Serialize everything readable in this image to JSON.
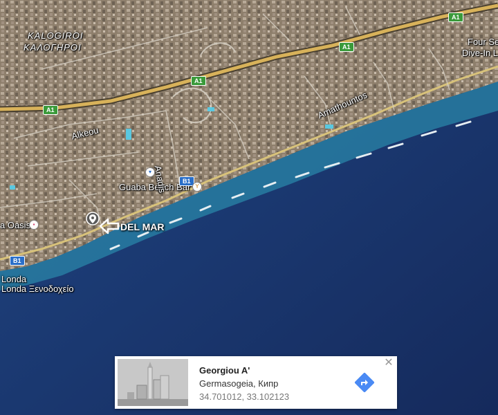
{
  "map": {
    "places": {
      "kalogiroi_latin": "KALOGIROI",
      "kalogiroi_greek": "ΚΑΛΟΓΗΡΟΙ",
      "four_seasons": "Four Se",
      "dive_in": "Dive-In L",
      "oasis": "a Oasis",
      "londa": "Londa",
      "londa_greek": "Londa Ξενοδοχείο",
      "guaba": "Guaba Beach Bar"
    },
    "roads": {
      "alkeou": "Alkeou",
      "amathountos": "Amathountos",
      "anadis": "Anadis"
    },
    "shields": {
      "a1": "A1",
      "b1": "B1"
    },
    "marker": {
      "label": "DEL MAR"
    },
    "colors": {
      "sea": "#1a3468",
      "land": "#8a7a66",
      "highway": "#d8b25a",
      "road": "#cfcfcf"
    }
  },
  "info_card": {
    "title": "Georgiou A'",
    "subtitle": "Germasogeia, Кипр",
    "coordinates": "34.701012, 33.102123",
    "close_icon": "close-icon",
    "directions_icon": "directions-icon"
  }
}
